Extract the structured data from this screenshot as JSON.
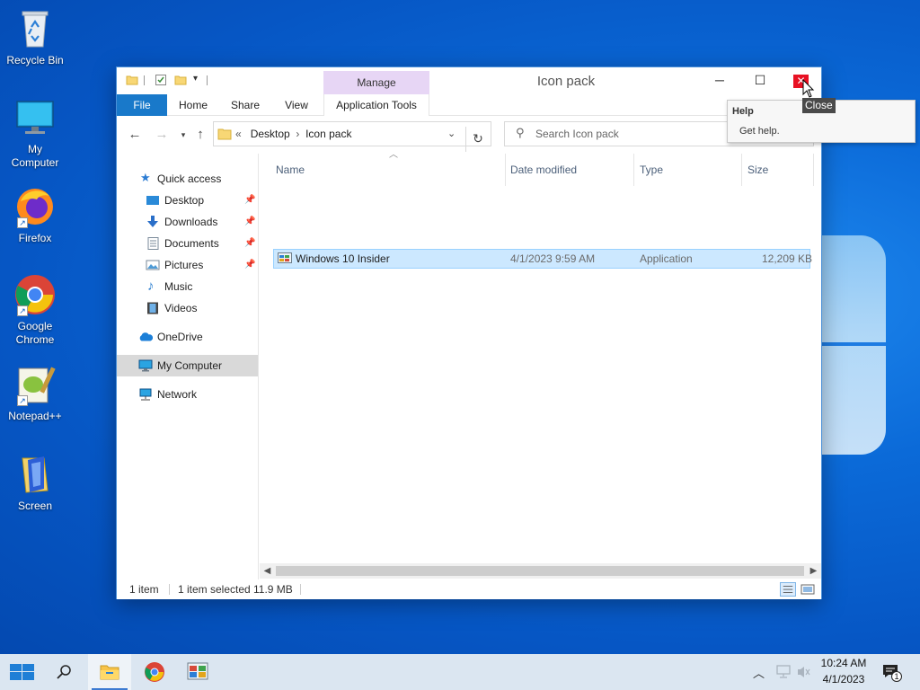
{
  "desktop": {
    "icons": [
      {
        "label": "Recycle Bin"
      },
      {
        "label": "My Computer"
      },
      {
        "label": "Firefox"
      },
      {
        "label": "Google Chrome"
      },
      {
        "label": "Notepad++"
      },
      {
        "label": "Screen"
      }
    ]
  },
  "window": {
    "title": "Icon pack",
    "contextual_tab_group": "Manage",
    "ribbon_tabs": {
      "file": "File",
      "home": "Home",
      "share": "Share",
      "view": "View",
      "app_tools": "Application Tools"
    },
    "address": {
      "overflow": "«",
      "crumbs": [
        "Desktop",
        "Icon pack"
      ]
    },
    "search": {
      "placeholder": "Search Icon pack"
    },
    "nav_pane": {
      "quick_access": "Quick access",
      "pinned": [
        {
          "label": "Desktop",
          "pinned": true
        },
        {
          "label": "Downloads",
          "pinned": true
        },
        {
          "label": "Documents",
          "pinned": true
        },
        {
          "label": "Pictures",
          "pinned": true
        },
        {
          "label": "Music",
          "pinned": false
        },
        {
          "label": "Videos",
          "pinned": false
        }
      ],
      "onedrive": "OneDrive",
      "this_pc": "My Computer",
      "network": "Network"
    },
    "columns": {
      "name": "Name",
      "date_modified": "Date modified",
      "type": "Type",
      "size": "Size"
    },
    "files": [
      {
        "name": "Windows 10 Insider",
        "date_modified": "4/1/2023 9:59 AM",
        "type": "Application",
        "size": "12,209 KB"
      }
    ],
    "status": {
      "count": "1 item",
      "selection": "1 item selected",
      "selection_size": "11.9 MB"
    }
  },
  "tooltip": {
    "close_label": "Close",
    "help_title": "Help",
    "help_body": "Get help."
  },
  "taskbar": {
    "time": "10:24 AM",
    "date": "4/1/2023",
    "notification_count": "1"
  }
}
